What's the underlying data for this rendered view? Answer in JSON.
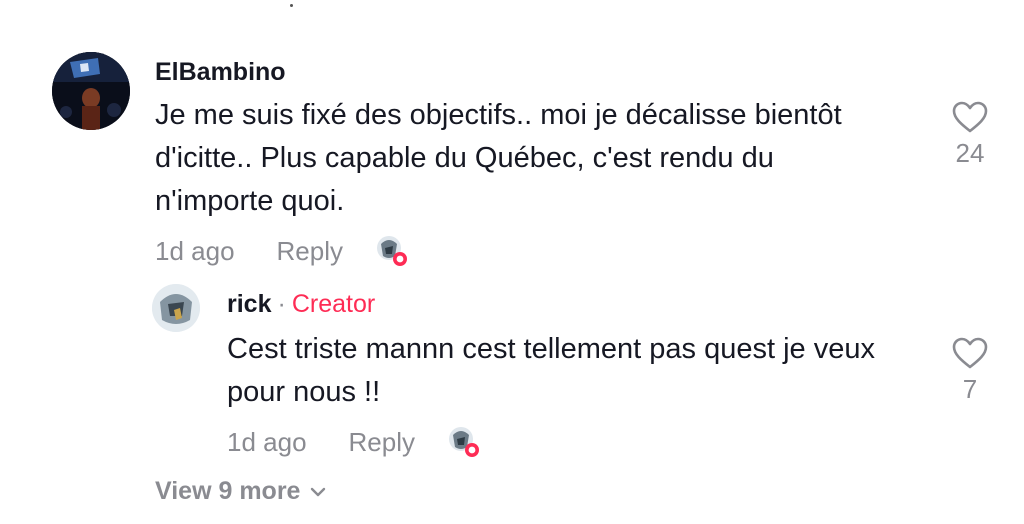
{
  "comment": {
    "username": "ElBambino",
    "text": "Je me suis fixé des objectifs.. moi je décalisse bientôt d'icitte.. Plus capable du Québec, c'est rendu du n'importe quoi.",
    "time": "1d ago",
    "reply_label": "Reply",
    "like_count": "24"
  },
  "reply": {
    "username": "rick",
    "separator": "·",
    "badge": "Creator",
    "text": "Cest triste mannn cest tellement pas quest je veux pour nous !!",
    "time": "1d ago",
    "reply_label": "Reply",
    "like_count": "7"
  },
  "view_more": {
    "label": "View 9 more"
  },
  "colors": {
    "creator_accent": "#fe2c55",
    "meta_gray": "#8a8b91",
    "text_dark": "#161823"
  },
  "icons": {
    "like": "heart-outline-icon",
    "creator_liked": "creator-avatar-heart-badge-icon",
    "expand": "chevron-down-icon"
  }
}
